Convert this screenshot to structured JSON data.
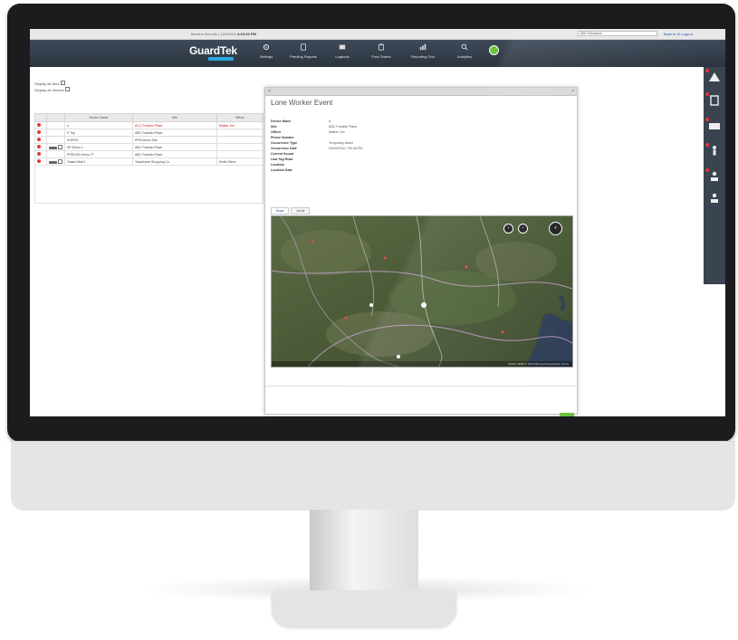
{
  "topbar": {
    "user": "Mustine Bruenis",
    "date": "12/6/2016",
    "time": "4:15:32 PM",
    "account_select": "ABC Education",
    "links": "Back to UI  Logout"
  },
  "brand": {
    "name": "GuardTek"
  },
  "nav": [
    {
      "label": "Settings",
      "icon": "gear-icon"
    },
    {
      "label": "Pending Reports",
      "icon": "document-icon"
    },
    {
      "label": "Logbook",
      "icon": "book-icon"
    },
    {
      "label": "Post Orders",
      "icon": "clipboard-icon"
    },
    {
      "label": "Reporting Tool",
      "icon": "chart-icon"
    },
    {
      "label": "Analytics",
      "icon": "search-icon"
    }
  ],
  "filters": {
    "display_sites": "Display all sites",
    "display_devices": "Display all devices"
  },
  "device_table": {
    "columns": [
      "Device Name",
      "Site",
      "Officer"
    ],
    "rows": [
      {
        "name": "a",
        "site": "ACC Franklin Place",
        "officer": "Walker Jim",
        "alert": true,
        "tag": false
      },
      {
        "name": "P Top",
        "site": "ABC Franklin Place",
        "officer": "",
        "alert": true,
        "tag": false
      },
      {
        "name": "KGRPH",
        "site": "PPM Demo Site",
        "officer": "",
        "alert": true,
        "tag": false
      },
      {
        "name": "SP Demo 1",
        "site": "ABC Franklin Place",
        "officer": "",
        "alert": true,
        "tag": true
      },
      {
        "name": "PPM iOS Demo TT",
        "site": "ABC Franklin Place",
        "officer": "",
        "alert": true,
        "tag": false
      },
      {
        "name": "Galant Mall 1",
        "site": "Townhome Shopping Co",
        "officer": "Smith Steve",
        "alert": true,
        "tag": true
      }
    ]
  },
  "modal": {
    "title": "Lone Worker Event",
    "fields": [
      {
        "key": "Device Name",
        "value": "a"
      },
      {
        "key": "Site",
        "value": "ABC Franklin Place"
      },
      {
        "key": "Officer",
        "value": "Walker Jim"
      },
      {
        "key": "Phone Number",
        "value": ""
      },
      {
        "key": "Occurrence Type",
        "value": "Temporary Alarm"
      },
      {
        "key": "Occurrence Date",
        "value": "09/09/2016 7:59:46 PM"
      },
      {
        "key": "Current Sound",
        "value": ""
      },
      {
        "key": "Last Tag Read",
        "value": ""
      },
      {
        "key": "Location",
        "value": ""
      },
      {
        "key": "Location Date",
        "value": ""
      }
    ],
    "map_tabs": [
      "Road",
      "Aerial"
    ],
    "map_attribution": "©2016 HERE  © 2016 Microsoft Corporation  Terms"
  },
  "colors": {
    "nav_bg": "#2b3440",
    "accent_green": "#6ac43a",
    "alert_red": "#e23b2b",
    "link_blue": "#1a4a9c"
  }
}
